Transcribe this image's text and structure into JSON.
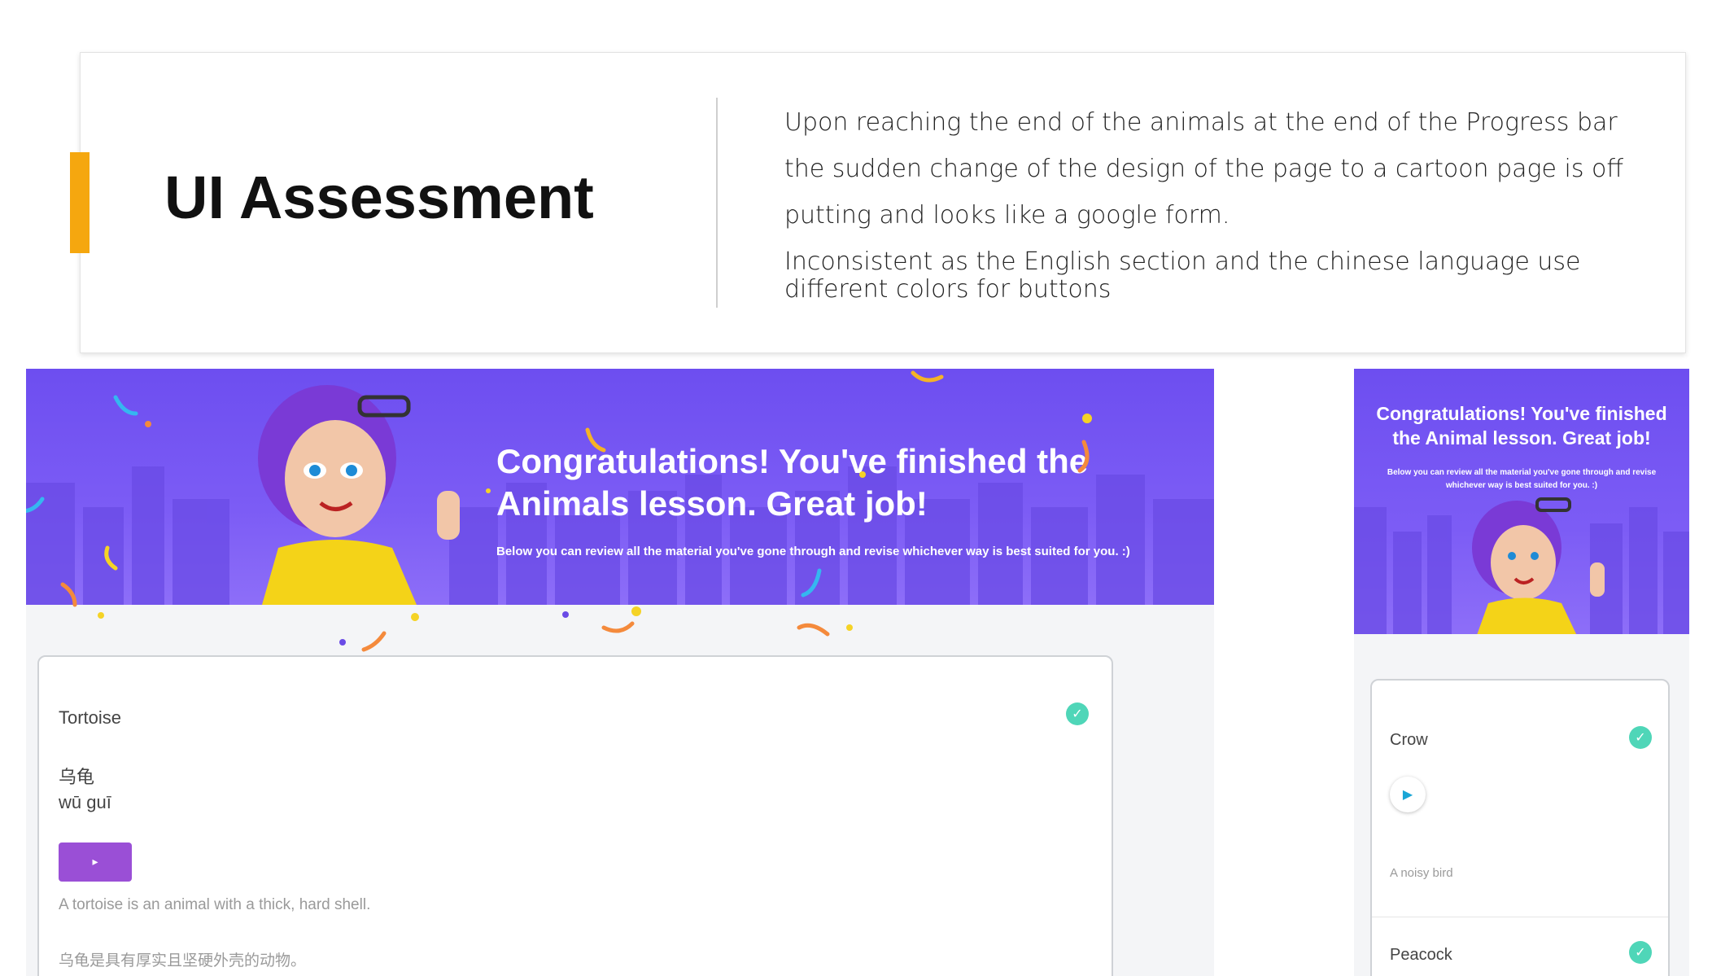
{
  "slide": {
    "title": "UI Assessment",
    "accent_color": "#f5a70f",
    "notes": {
      "p1": "Upon reaching the end of the animals at the end of the Progress bar the sudden change of the design of the page to a cartoon page is off putting and looks like a google form.",
      "p2": "Inconsistent as the English section and the chinese language use different colors for buttons"
    }
  },
  "left_screen": {
    "banner_title": "Congratulations! You've finished the Animals lesson. Great job!",
    "banner_sub": "Below you can review all the material you've gone through and revise whichever way is best suited for you. :)",
    "card": {
      "word": "Tortoise",
      "chinese": "乌龟",
      "pinyin": "wū guī",
      "play_icon": "▸",
      "desc_en": "A tortoise is an animal with a thick, hard shell.",
      "desc_zh": "乌龟是具有厚实且坚硬外壳的动物。",
      "check_icon": "✓"
    }
  },
  "right_screen": {
    "banner_title": "Congratulations! You've finished the Animal lesson. Great job!",
    "banner_sub": "Below you can review all the material you've gone through and revise whichever way is best suited for you. :)",
    "card": {
      "word1": "Crow",
      "play_icon": "▶",
      "desc1": "A noisy bird",
      "word2": "Peacock",
      "check_icon": "✓"
    }
  },
  "colors": {
    "banner": "#7356f2",
    "check": "#4fd6b8",
    "play_button": "#9a4fd6",
    "play_icon_blue": "#1aa6d6"
  }
}
